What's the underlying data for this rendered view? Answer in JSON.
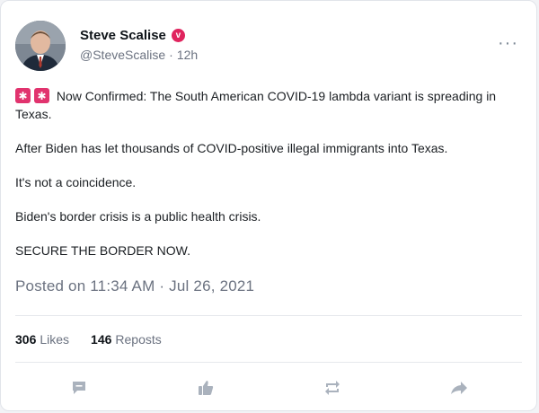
{
  "post": {
    "author_name": "Steve Scalise",
    "handle": "@SteveScalise",
    "separator": "·",
    "age": "12h",
    "verified_mark": "v",
    "more_label": "···",
    "paragraphs": [
      "Now Confirmed: The South American COVID-19 lambda variant is spreading in Texas.",
      "After Biden has let thousands of COVID-positive illegal immigrants into Texas.",
      "It's not a coincidence.",
      "Biden's border crisis is a public health crisis.",
      "SECURE THE BORDER NOW."
    ],
    "lead_emoji": [
      "siren-emoji",
      "siren-emoji"
    ],
    "posted_line": "Posted on 11:34 AM · Jul 26, 2021"
  },
  "stats": {
    "likes_count": "306",
    "likes_label": "Likes",
    "reposts_count": "146",
    "reposts_label": "Reposts"
  },
  "actions": [
    "comment-icon",
    "like-icon",
    "repost-icon",
    "share-icon"
  ],
  "colors": {
    "verified_badge": "#e0245e",
    "emoji_red": "#e1336e",
    "action_icon": "#aab2bd",
    "muted_text": "#6b7280"
  }
}
